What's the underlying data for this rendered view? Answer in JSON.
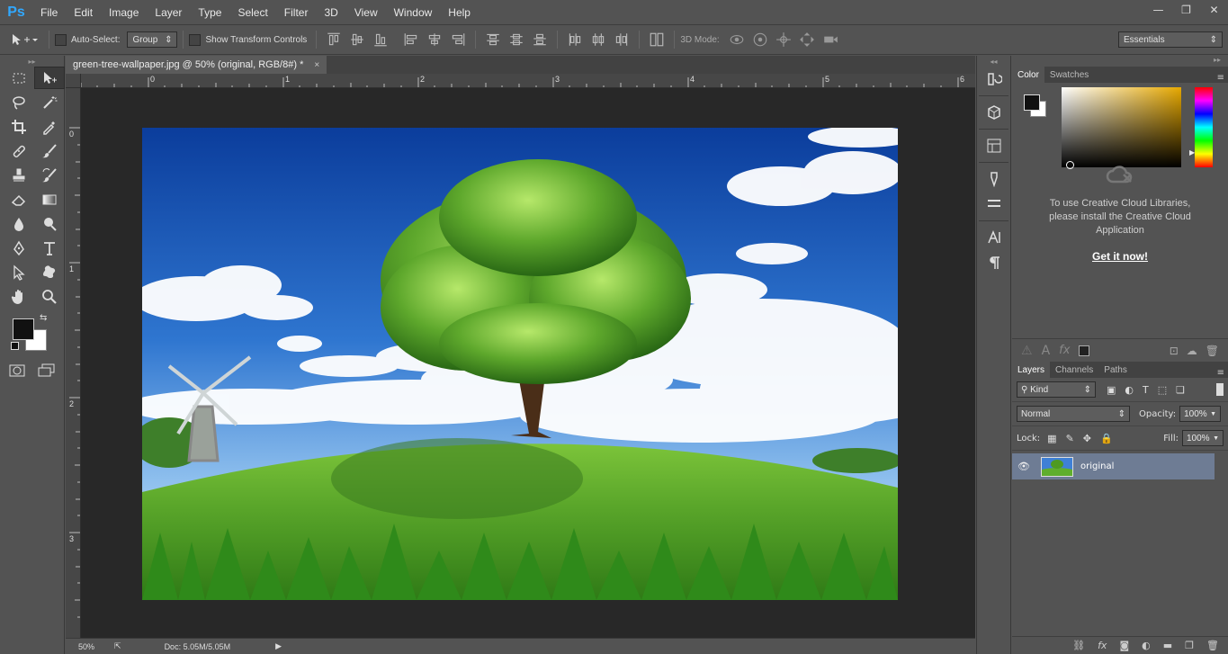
{
  "app": {
    "logo": "Ps"
  },
  "menu": [
    "File",
    "Edit",
    "Image",
    "Layer",
    "Type",
    "Select",
    "Filter",
    "3D",
    "View",
    "Window",
    "Help"
  ],
  "window_controls": {
    "minimize": "—",
    "restore": "❐",
    "close": "✕"
  },
  "options": {
    "auto_select_label": "Auto-Select:",
    "auto_select_value": "Group",
    "show_transform_label": "Show Transform Controls",
    "mode_3d_label": "3D Mode:",
    "workspace": "Essentials"
  },
  "document": {
    "tab_title": "green-tree-wallpaper.jpg @ 50% (original, RGB/8#) *",
    "close": "×",
    "h_ruler": [
      "0",
      "1",
      "2",
      "3",
      "4",
      "5",
      "6"
    ],
    "v_ruler": [
      "0",
      "1",
      "2",
      "3"
    ]
  },
  "status": {
    "zoom": "50%",
    "doc": "Doc: 5.05M/5.05M"
  },
  "color_panel": {
    "tabs": [
      "Color",
      "Swatches"
    ],
    "active": "Color"
  },
  "libraries": {
    "message": [
      "To use Creative Cloud Libraries,",
      "please install the Creative Cloud",
      "Application"
    ],
    "link": "Get it now!"
  },
  "layers_panel": {
    "tabs": [
      "Layers",
      "Channels",
      "Paths"
    ],
    "active": "Layers",
    "kind": "Kind",
    "blend_mode": "Normal",
    "opacity_label": "Opacity:",
    "opacity": "100%",
    "lock_label": "Lock:",
    "fill_label": "Fill:",
    "fill": "100%",
    "layers": [
      {
        "name": "original",
        "visible": true
      }
    ]
  }
}
